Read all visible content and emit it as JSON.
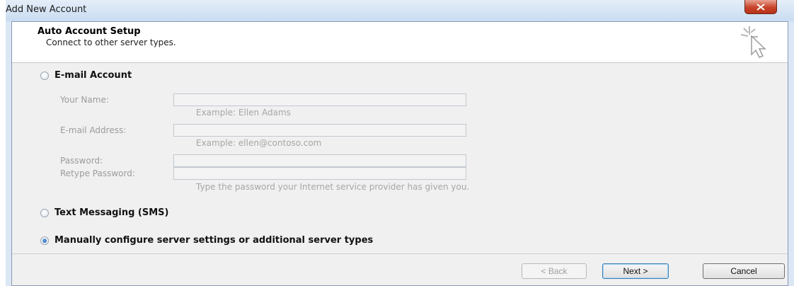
{
  "window": {
    "title": "Add New Account"
  },
  "header": {
    "title": "Auto Account Setup",
    "subtitle": "Connect to other server types."
  },
  "options": [
    {
      "label": "E-mail Account",
      "selected": false,
      "enabled": true
    },
    {
      "label": "Text Messaging (SMS)",
      "selected": false,
      "enabled": true
    },
    {
      "label": "Manually configure server settings or additional server types",
      "selected": true,
      "enabled": true
    }
  ],
  "email_form": {
    "your_name": {
      "label": "Your Name:",
      "value": "",
      "hint": "Example: Ellen Adams"
    },
    "email_address": {
      "label": "E-mail Address:",
      "value": "",
      "hint": "Example: ellen@contoso.com"
    },
    "password": {
      "label": "Password:",
      "value": ""
    },
    "retype_password": {
      "label": "Retype Password:",
      "value": "",
      "hint": "Type the password your Internet service provider has given you."
    }
  },
  "buttons": {
    "back": "< Back",
    "next": "Next >",
    "cancel": "Cancel"
  },
  "colors": {
    "titlebar": "#c9dcf1",
    "close_button": "#c8432a",
    "dialog_background": "#f0f0f0",
    "default_button_border": "#3c7fb1"
  },
  "icons": [
    "close-icon",
    "wizard-cursor-icon"
  ]
}
